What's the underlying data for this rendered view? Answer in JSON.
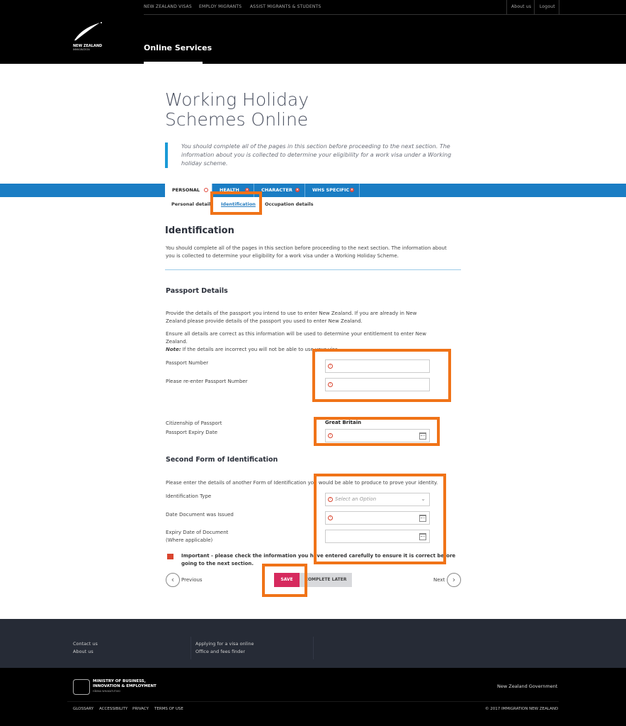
{
  "header": {
    "top_nav": [
      "NEW ZEALAND VISAS",
      "EMPLOY MIGRANTS",
      "ASSIST MIGRANTS & STUDENTS"
    ],
    "about": "About us",
    "logout": "Logout",
    "logo_text": "NEW ZEALAND",
    "logo_sub": "IMMIGRATION",
    "section": "Online Services"
  },
  "page": {
    "title_line1": "Working Holiday",
    "title_line2": "Schemes Online",
    "intro": "You should complete all of the pages in this section before proceeding to the next section. The information about you is collected to determine your eligibility for a work visa under a Working holiday scheme."
  },
  "tabs": [
    {
      "label": "PERSONAL",
      "active": true
    },
    {
      "label": "HEALTH"
    },
    {
      "label": "CHARACTER"
    },
    {
      "label": "WHS SPECIFIC"
    }
  ],
  "subtabs": [
    {
      "label": "Personal details"
    },
    {
      "label": "Identification",
      "active": true
    },
    {
      "label": "Occupation details"
    }
  ],
  "section": {
    "title": "Identification",
    "desc": "You should complete all of the pages in this section before proceeding to the next section. The information about you is collected to determine your eligibility for a work visa under a Working Holiday Scheme."
  },
  "passport": {
    "title": "Passport Details",
    "p1": "Provide the details of the passport you intend to use to enter New Zealand. If you are already in New Zealand please provide details of the passport you used to enter New Zealand.",
    "p2": "Ensure all details are correct as this information will be used to determine your entitlement to enter New Zealand.",
    "note_label": "Note:",
    "note": " If the details are incorrect you will not be able to use your visa.",
    "number_label": "Passport Number",
    "reenter_label": "Please re-enter Passport Number",
    "citizenship_label": "Citizenship of Passport",
    "citizenship_value": "Great Britain",
    "expiry_label": "Passport Expiry Date"
  },
  "second_id": {
    "title": "Second Form of Identification",
    "p": "Please enter the details of another Form of Identification you would be able to produce to prove your identity.",
    "type_label": "Identification Type",
    "type_placeholder": "Select an Option",
    "issued_label": "Date Document was Issued",
    "expiry_label": "Expiry Date of Document",
    "expiry_sub": "(Where applicable)"
  },
  "important": "Important - please check the information you have entered carefully to ensure it is correct before going to the next section.",
  "buttons": {
    "previous": "Previous",
    "save": "SAVE",
    "complete_later": "COMPLETE LATER",
    "next": "Next"
  },
  "footer": {
    "col1": [
      "Contact us",
      "About us"
    ],
    "col2": [
      "Applying for a visa online",
      "Office and fees finder"
    ],
    "mbie1": "MINISTRY OF BUSINESS,",
    "mbie2": "INNOVATION & EMPLOYMENT",
    "mbie3": "HĪKINA WHAKATUTUKI",
    "nzgov": "New Zealand Government",
    "links": [
      "GLOSSARY",
      "ACCESSIBILITY",
      "PRIVACY",
      "TERMS OF USE"
    ],
    "copyright": "© 2017 IMMIGRATION NEW ZEALAND"
  },
  "colors": {
    "tab_blue": "#1a7dc4",
    "save": "#d62a5e",
    "annotation": "#f07318",
    "footer": "#262b36"
  }
}
